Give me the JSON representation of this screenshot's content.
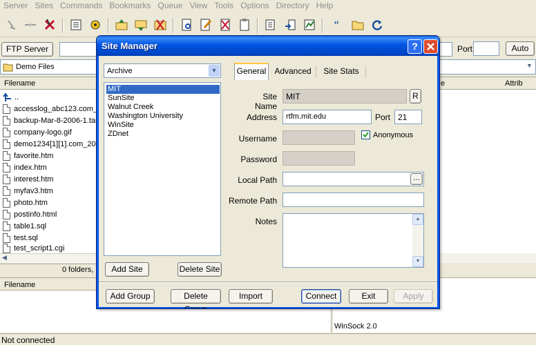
{
  "menu": [
    "Server",
    "Sites",
    "Commands",
    "Bookmarks",
    "Queue",
    "View",
    "Tools",
    "Options",
    "Directory",
    "Help"
  ],
  "connect_bar": {
    "ftp_server_button": "FTP Server",
    "port_label": "Port",
    "auto_button": "Auto"
  },
  "local": {
    "path": "Demo Files",
    "column_filename": "Filename",
    "files": [
      "..",
      "accesslog_abc123.com_",
      "backup-Mar-8-2006-1.tar",
      "company-logo.gif",
      "demo1234[1][1].com_20",
      "favorite.htm",
      "index.htm",
      "interest.htm",
      "myfav3.htm",
      "photo.htm",
      "postinfo.html",
      "table1.sql",
      "test.sql",
      "test_script1.cgi"
    ],
    "status": "0 folders,"
  },
  "remote": {
    "column_size": "e",
    "column_attrib": "Attrib"
  },
  "queue": {
    "column_filename": "Filename",
    "winsock": "WinSock 2.0"
  },
  "status_bar": "Not connected",
  "site_manager": {
    "title": "Site Manager",
    "help_button": "?",
    "close_button": "X",
    "group_select": "Archive",
    "sites": [
      "MIT",
      "SunSite",
      "Walnut Creek",
      "Washington University",
      "WinSite",
      "ZDnet"
    ],
    "selected_site": "MIT",
    "tabs": [
      "General",
      "Advanced",
      "Site Stats"
    ],
    "active_tab": "General",
    "fields": {
      "site_name_label": "Site Name",
      "site_name": "MIT",
      "rename_button": "R",
      "address_label": "Address",
      "address": "rtfm.mit.edu",
      "port_label": "Port",
      "port": "21",
      "username_label": "Username",
      "anonymous_label": "Anonymous",
      "anonymous_checked": true,
      "password_label": "Password",
      "local_path_label": "Local Path",
      "browse_button": "...",
      "remote_path_label": "Remote Path",
      "notes_label": "Notes"
    },
    "buttons": {
      "add_site": "Add Site",
      "delete_site": "Delete Site",
      "add_group": "Add Group",
      "delete_group": "Delete Group",
      "import": "Import",
      "connect": "Connect",
      "exit": "Exit",
      "apply": "Apply"
    }
  },
  "colors": {
    "title_blue": "#0054e3",
    "close_red": "#e04b2b",
    "selection": "#316ac5",
    "tab_accent": "#ffc83c"
  }
}
